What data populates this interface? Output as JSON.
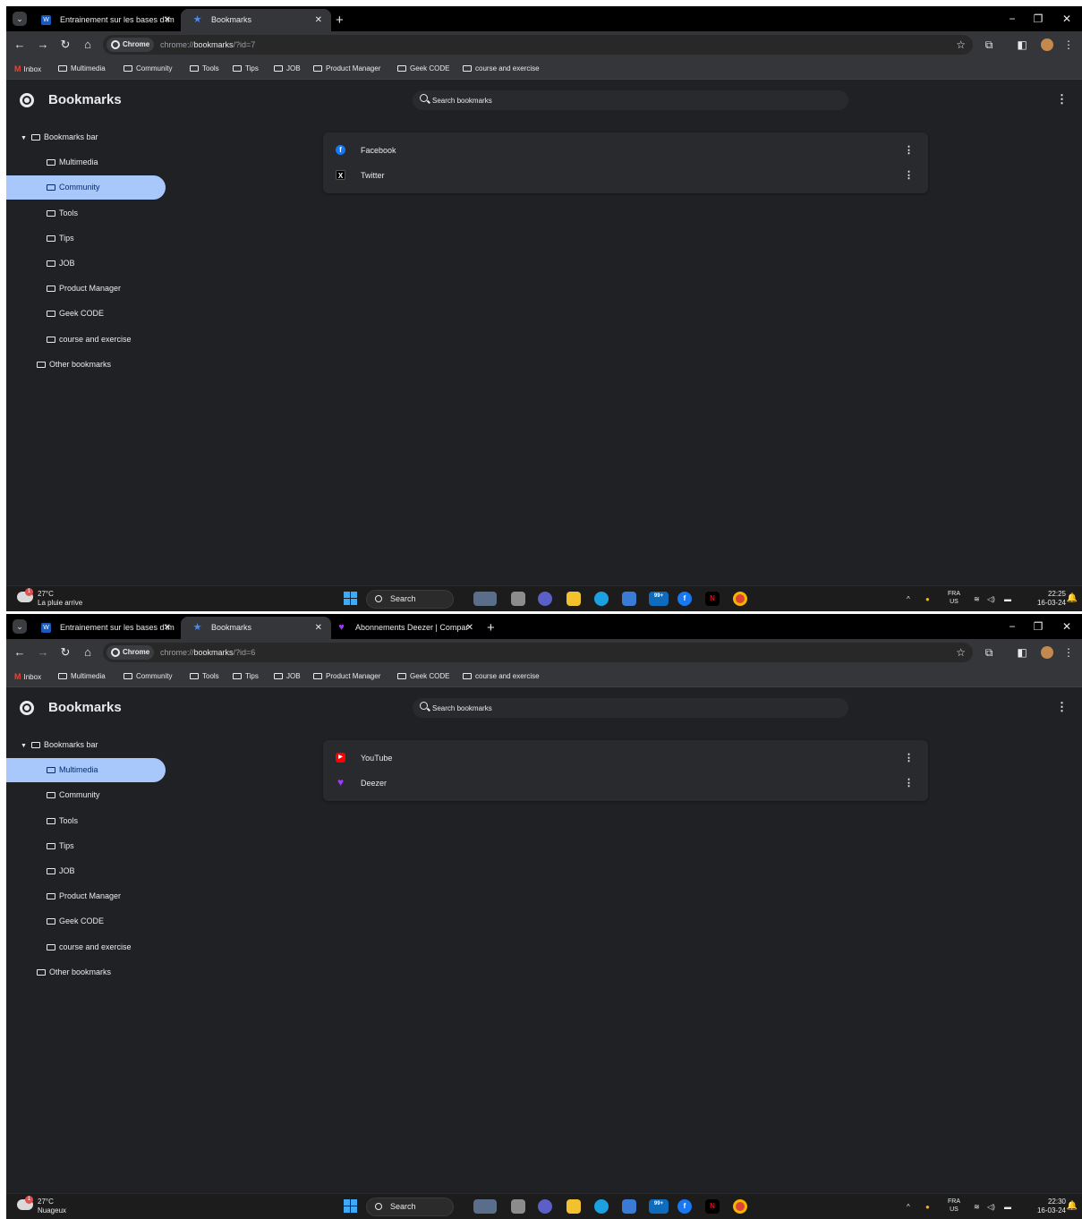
{
  "shots": [
    {
      "tabs": [
        {
          "label": "Entrainement sur les bases d'im",
          "icon": "word-doc-icon",
          "active": false
        },
        {
          "label": "Bookmarks",
          "icon": "star-icon",
          "active": true
        }
      ],
      "omnibox": {
        "chip": "Chrome",
        "url_scheme": "chrome://",
        "url_host": "bookmarks",
        "url_rest": "/?id=7"
      },
      "bookmarks_bar": [
        "Inbox",
        "Multimedia",
        "Community",
        "Tools",
        "Tips",
        "JOB",
        "Product Manager",
        "Geek CODE",
        "course and exercise"
      ],
      "page_title": "Bookmarks",
      "search_placeholder": "Search bookmarks",
      "sidebar": [
        "Bookmarks bar",
        "Multimedia",
        "Community",
        "Tools",
        "Tips",
        "JOB",
        "Product Manager",
        "Geek CODE",
        "course and exercise",
        "Other bookmarks"
      ],
      "selected_folder": "Community",
      "items": [
        {
          "label": "Facebook",
          "icon": "facebook-icon",
          "color": "#1877f2"
        },
        {
          "label": "Twitter",
          "icon": "x-icon",
          "color": "#000000"
        }
      ],
      "taskbar": {
        "temp": "27°C",
        "weather_text": "La pluie arrive",
        "search": "Search",
        "lang": "FRA",
        "region": "US",
        "time": "22:25",
        "date": "16-03-24",
        "badge": "1",
        "mail_badge": "99+"
      }
    },
    {
      "tabs": [
        {
          "label": "Entrainement sur les bases d'im",
          "icon": "word-doc-icon",
          "active": false
        },
        {
          "label": "Bookmarks",
          "icon": "star-icon",
          "active": true
        },
        {
          "label": "Abonnements Deezer | Compar",
          "icon": "deezer-heart-icon",
          "active": false
        }
      ],
      "omnibox": {
        "chip": "Chrome",
        "url_scheme": "chrome://",
        "url_host": "bookmarks",
        "url_rest": "/?id=6"
      },
      "bookmarks_bar": [
        "Inbox",
        "Multimedia",
        "Community",
        "Tools",
        "Tips",
        "JOB",
        "Product Manager",
        "Geek CODE",
        "course and exercise"
      ],
      "page_title": "Bookmarks",
      "search_placeholder": "Search bookmarks",
      "sidebar": [
        "Bookmarks bar",
        "Multimedia",
        "Community",
        "Tools",
        "Tips",
        "JOB",
        "Product Manager",
        "Geek CODE",
        "course and exercise",
        "Other bookmarks"
      ],
      "selected_folder": "Multimedia",
      "items": [
        {
          "label": "YouTube",
          "icon": "youtube-icon",
          "color": "#ff0000"
        },
        {
          "label": "Deezer",
          "icon": "deezer-heart-icon",
          "color": "#a238ff"
        }
      ],
      "taskbar": {
        "temp": "27°C",
        "weather_text": "Nuageux",
        "search": "Search",
        "lang": "FRA",
        "region": "US",
        "time": "22:30",
        "date": "16-03-24",
        "badge": "1",
        "mail_badge": "99+"
      }
    }
  ],
  "colors": {
    "page_bg": "#202124",
    "toolbar": "#35363a",
    "selection": "#a8c7fa",
    "selection_text": "#062e6f"
  }
}
